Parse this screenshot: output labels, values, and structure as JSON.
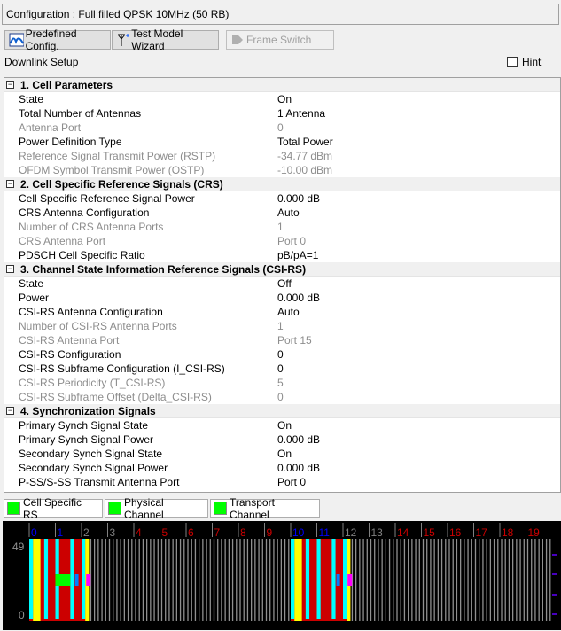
{
  "configuration": "Configuration : Full filled QPSK 10MHz (50 RB)",
  "toolbar": {
    "predefined": "Predefined Config.",
    "wizard": "Test Model Wizard",
    "frame_switch": "Frame Switch"
  },
  "downlink_label": "Downlink Setup",
  "hint_label": "Hint",
  "hint_checked": false,
  "sections": [
    {
      "title": "1. Cell Parameters",
      "rows": [
        {
          "name": "State",
          "value": "On",
          "disabled": false
        },
        {
          "name": "Total Number of Antennas",
          "value": "1 Antenna",
          "disabled": false
        },
        {
          "name": "Antenna Port",
          "value": "0",
          "disabled": true
        },
        {
          "name": "Power Definition Type",
          "value": "Total Power",
          "disabled": false
        },
        {
          "name": "Reference Signal Transmit Power (RSTP)",
          "value": "-34.77 dBm",
          "disabled": true
        },
        {
          "name": "OFDM Symbol Transmit Power (OSTP)",
          "value": "-10.00 dBm",
          "disabled": true
        }
      ]
    },
    {
      "title": "2. Cell Specific Reference Signals (CRS)",
      "rows": [
        {
          "name": "Cell Specific Reference Signal Power",
          "value": "0.000 dB",
          "disabled": false
        },
        {
          "name": "CRS Antenna Configuration",
          "value": "Auto",
          "disabled": false
        },
        {
          "name": "Number of CRS Antenna Ports",
          "value": "1",
          "disabled": true
        },
        {
          "name": "CRS Antenna Port",
          "value": "Port 0",
          "disabled": true
        },
        {
          "name": "PDSCH Cell Specific Ratio",
          "value": "pB/pA=1",
          "disabled": false
        }
      ]
    },
    {
      "title": "3. Channel State Information Reference Signals (CSI-RS)",
      "rows": [
        {
          "name": "State",
          "value": "Off",
          "disabled": false
        },
        {
          "name": "Power",
          "value": "0.000 dB",
          "disabled": false
        },
        {
          "name": "CSI-RS Antenna Configuration",
          "value": "Auto",
          "disabled": false
        },
        {
          "name": "Number of CSI-RS Antenna Ports",
          "value": "1",
          "disabled": true
        },
        {
          "name": "CSI-RS Antenna Port",
          "value": "Port 15",
          "disabled": true
        },
        {
          "name": "CSI-RS Configuration",
          "value": "0",
          "disabled": false
        },
        {
          "name": "CSI-RS Subframe Configuration (I_CSI-RS)",
          "value": "0",
          "disabled": false
        },
        {
          "name": "CSI-RS Periodicity (T_CSI-RS)",
          "value": "5",
          "disabled": true
        },
        {
          "name": "CSI-RS Subframe Offset (Delta_CSI-RS)",
          "value": "0",
          "disabled": true
        }
      ]
    },
    {
      "title": "4. Synchronization Signals",
      "rows": [
        {
          "name": "Primary Synch Signal State",
          "value": "On",
          "disabled": false
        },
        {
          "name": "Primary Synch Signal Power",
          "value": "0.000 dB",
          "disabled": false
        },
        {
          "name": "Secondary Synch Signal State",
          "value": "On",
          "disabled": false
        },
        {
          "name": "Secondary Synch Signal Power",
          "value": "0.000 dB",
          "disabled": false
        },
        {
          "name": "P-SS/S-SS Transmit Antenna Port",
          "value": "Port 0",
          "disabled": false
        }
      ]
    }
  ],
  "legend_tabs": [
    {
      "label": "Cell Specific RS",
      "color": "#00ff00"
    },
    {
      "label": "Physical Channel",
      "color": "#00ff00"
    },
    {
      "label": "Transport Channel",
      "color": "#00ff00"
    }
  ],
  "frame_view": {
    "y_top_label": "49",
    "y_bottom_label": "0",
    "slots": [
      "0",
      "1",
      "2",
      "3",
      "4",
      "5",
      "6",
      "7",
      "8",
      "9",
      "10",
      "11",
      "12",
      "13",
      "14",
      "15",
      "16",
      "17",
      "18",
      "19"
    ],
    "slot_label_colors": {
      "downlink": "#0000ff",
      "special": "#808080",
      "other": "#cc0000"
    },
    "colors": {
      "crs": "#00ffff",
      "pdcch": "#ffff00",
      "pdsch": "#cc0000",
      "pbch": "#00ff00",
      "sss": "#0080ff",
      "pss": "#ff00ff"
    }
  }
}
